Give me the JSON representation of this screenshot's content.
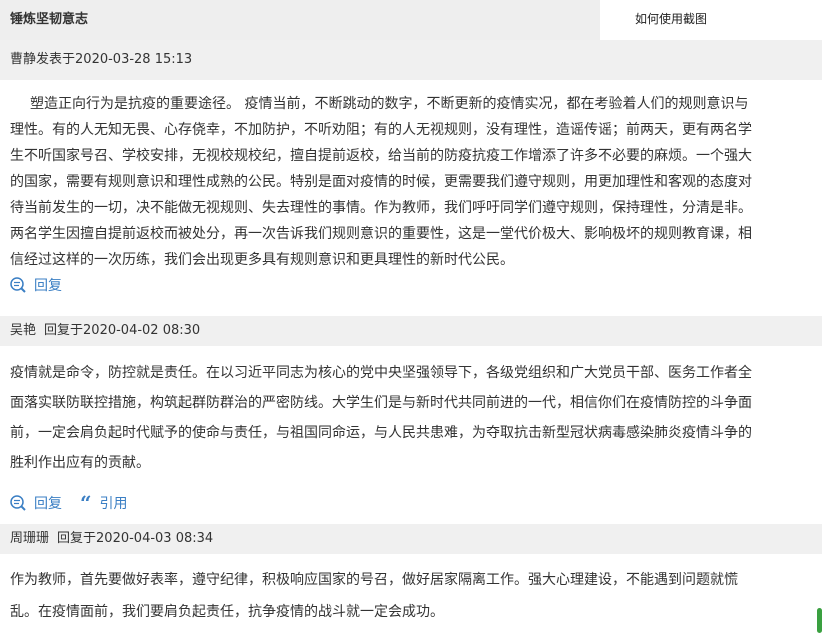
{
  "topic": {
    "title": "锤炼坚韧意志",
    "help_link": "如何使用截图"
  },
  "posts": [
    {
      "author": "曹静",
      "action": "发表于",
      "timestamp": "2020-03-28 15:13",
      "body_lines": [
        "塑造正向行为是抗疫的重要途径。 疫情当前，不断跳动的数字，不断更新的疫情实况，都在考验着人们的规则意识与",
        "理性。有的人无知无畏、心存侥幸，不加防护，不听劝阻；有的人无视规则，没有理性，造谣传谣；前两天，更有两名学",
        "生不听国家号召、学校安排，无视校规校纪，擅自提前返校，给当前的防疫抗疫工作增添了许多不必要的麻烦。一个强大",
        "的国家，需要有规则意识和理性成熟的公民。特别是面对疫情的时候，更需要我们遵守规则，用更加理性和客观的态度对",
        "待当前发生的一切，决不能做无视规则、失去理性的事情。作为教师，我们呼吁同学们遵守规则，保持理性，分清是非。",
        "两名学生因擅自提前返校而被处分，再一次告诉我们规则意识的重要性，这是一堂代价极大、影响极坏的规则教育课，相",
        "信经过这样的一次历练，我们会出现更多具有规则意识和更具理性的新时代公民。"
      ],
      "actions": {
        "reply": "回复"
      }
    },
    {
      "author": "吴艳",
      "action": "回复于",
      "timestamp": "2020-04-02 08:30",
      "body_lines": [
        "疫情就是命令，防控就是责任。在以习近平同志为核心的党中央坚强领导下，各级党组织和广大党员干部、医务工作者全",
        "面落实联防联控措施，构筑起群防群治的严密防线。大学生们是与新时代共同前进的一代，相信你们在疫情防控的斗争面",
        "前，一定会肩负起时代赋予的使命与责任，与祖国同命运，与人民共患难，为夺取抗击新型冠状病毒感染肺炎疫情斗争的",
        "胜利作出应有的贡献。"
      ],
      "actions": {
        "reply": "回复",
        "quote": "引用"
      }
    },
    {
      "author": "周珊珊",
      "action": "回复于",
      "timestamp": "2020-04-03 08:34",
      "body_lines": [
        "作为教师，首先要做好表率，遵守纪律，积极响应国家的号召，做好居家隔离工作。强大心理建设，不能遇到问题就慌",
        "乱。在疫情面前，我们要肩负起责任，抗争疫情的战斗就一定会成功。"
      ]
    }
  ],
  "colors": {
    "link": "#3b7fc4",
    "header_bg": "#f0f0f0",
    "title_bg": "#eeeeee",
    "text": "#333333",
    "scroll_thumb": "#3aa040"
  },
  "icons": {
    "reply": "comment-bubble-icon",
    "quote": "quote-icon"
  }
}
